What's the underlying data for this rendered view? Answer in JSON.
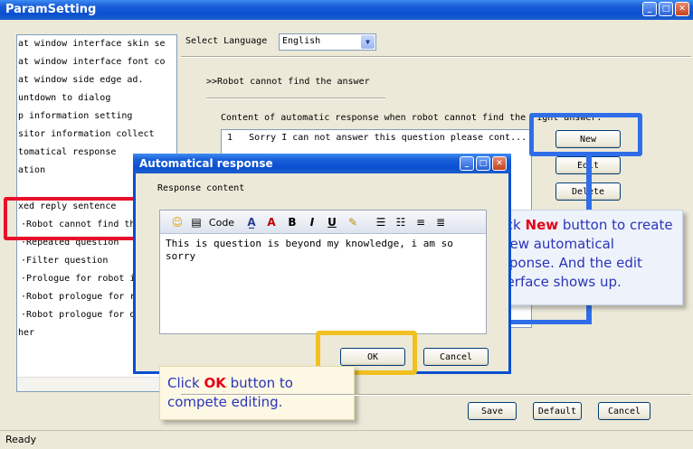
{
  "window": {
    "title": "ParamSetting"
  },
  "sidebar": {
    "items": [
      "at window interface skin se",
      "at window interface font co",
      "at window side edge ad.",
      "untdown to dialog",
      "p information setting",
      "sitor information collect",
      "tomatical response",
      "ation",
      "",
      "xed reply sentence",
      "Robot cannot find th",
      "Repeated question",
      "Filter question",
      "Prologue for robot i",
      "Robot prologue for r",
      "Robot prologue for o",
      "her"
    ]
  },
  "language": {
    "label": "Select Language",
    "value": "English"
  },
  "section": {
    "heading": ">>Robot cannot find the answer",
    "content_label": "Content of automatic response when robot cannot find the right answer:",
    "rows": [
      {
        "num": "1",
        "text": "Sorry I can not answer this question please cont..."
      }
    ]
  },
  "side_buttons": {
    "new": "New",
    "edit": "Edit",
    "delete": "Delete"
  },
  "dialog": {
    "title": "Automatical response",
    "label": "Response content",
    "toolbar": {
      "code": "Code"
    },
    "text": "This is question is beyond my knowledge, i am so sorry",
    "ok": "OK",
    "cancel": "Cancel"
  },
  "footer": {
    "save": "Save",
    "default": "Default",
    "cancel": "Cancel"
  },
  "status": "Ready",
  "callout_new": {
    "pre": "Click ",
    "hl": "New",
    "post": " button to create a new automatical response. And the edit interface shows up."
  },
  "callout_ok": {
    "pre": "Click ",
    "hl": "OK",
    "post": " button to compete editing."
  },
  "colors": {
    "highlight_red": "#e8102a",
    "highlight_blue": "#2f6ee8",
    "highlight_yellow": "#f0c020"
  }
}
